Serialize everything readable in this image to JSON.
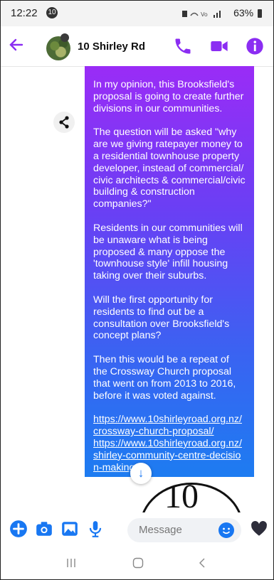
{
  "status_bar": {
    "time": "12:22",
    "notification_count": "10",
    "right": "63%"
  },
  "header": {
    "title": "10 Shirley Rd"
  },
  "message": {
    "paragraphs": [
      "In my opinion, this Brooksfield's proposal is going to create further divisions in our communities.",
      "The question will be asked \"why are we giving ratepayer money to a residential townhouse property developer, instead of commercial/ civic architects & commercial/civic building & construction companies?\"",
      "Residents in our communities will be unaware what is being proposed & many oppose the 'townhouse style' infill housing taking over their suburbs.",
      "Will the first opportunity for residents to find out be a consultation over Brooksfield's concept plans?",
      "Then this would be a repeat of the Crossway Church proposal that went on from 2013 to 2016, before it was voted against."
    ],
    "links": [
      "https://www.10shirleyroad.org.nz/crossway-church-proposal/",
      "https://www.10shirleyroad.org.nz/shirley-community-centre-decision-making/"
    ],
    "image_text": "10"
  },
  "input": {
    "placeholder": "Message"
  },
  "colors": {
    "accent": "#8b2df2",
    "messenger_blue": "#1877f2"
  },
  "icons": [
    "back-arrow-icon",
    "phone-icon",
    "video-icon",
    "info-icon",
    "share-icon",
    "plus-icon",
    "camera-icon",
    "gallery-icon",
    "microphone-icon",
    "emoji-icon",
    "heart-icon",
    "scroll-down-icon"
  ]
}
